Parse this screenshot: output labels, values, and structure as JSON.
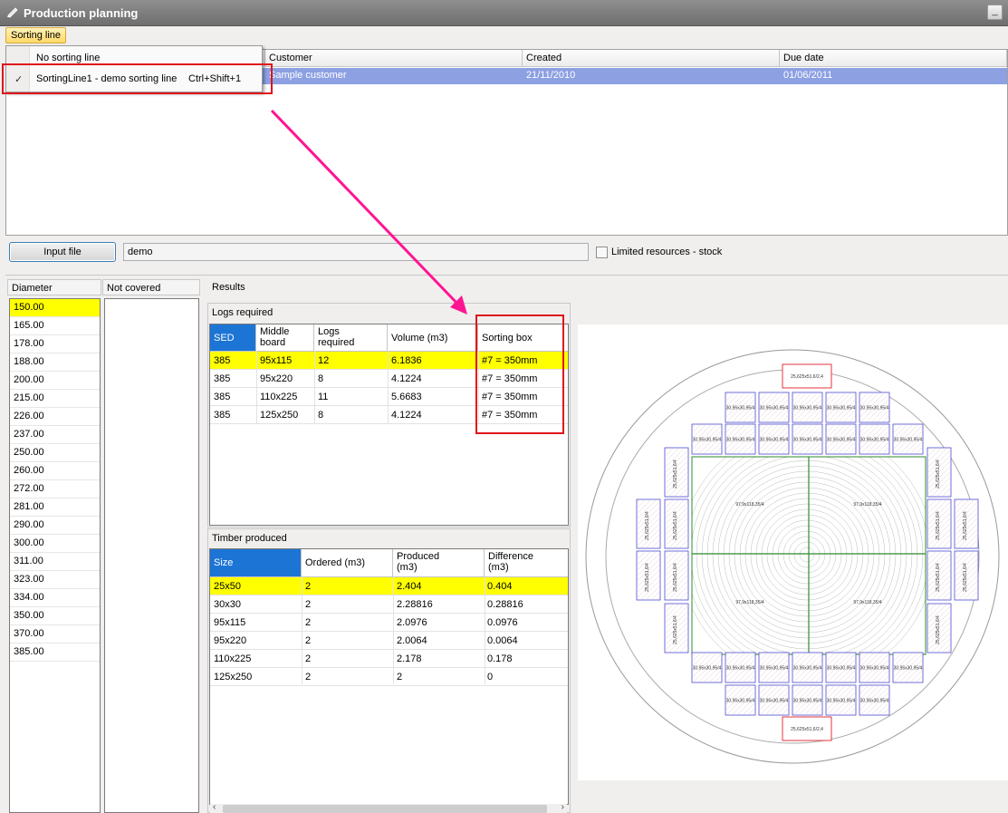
{
  "window": {
    "title": "Production planning",
    "minimize_glyph": "_"
  },
  "menu": {
    "sorting_line_label": "Sorting line"
  },
  "dropdown": {
    "option_none": "No sorting line",
    "option_selected": "SortingLine1 - demo sorting line",
    "option_shortcut": "Ctrl+Shift+1",
    "check_glyph": "✓"
  },
  "orders_grid": {
    "headers": [
      "Customer",
      "Created",
      "Due date"
    ],
    "row": {
      "customer": "Sample customer",
      "created": "21/11/2010",
      "due_date": "01/06/2011"
    }
  },
  "toolbar": {
    "input_file_label": "Input file",
    "file_value": "demo",
    "limited_resources_label": "Limited resources - stock"
  },
  "diameter_panel": {
    "title": "Diameter",
    "items": [
      "150.00",
      "165.00",
      "178.00",
      "188.00",
      "200.00",
      "215.00",
      "226.00",
      "237.00",
      "250.00",
      "260.00",
      "272.00",
      "281.00",
      "290.00",
      "300.00",
      "311.00",
      "323.00",
      "334.00",
      "350.00",
      "370.00",
      "385.00"
    ]
  },
  "not_covered_panel": {
    "title": "Not covered"
  },
  "results": {
    "title": "Results",
    "logs_required": {
      "title": "Logs required",
      "headers": {
        "sed": "SED",
        "middle_board": "Middle\nboard",
        "logs_required": "Logs\nrequired",
        "volume": "Volume (m3)",
        "sorting_box": "Sorting box"
      },
      "rows": [
        {
          "sed": "385",
          "middle_board": "95x115",
          "logs": "12",
          "volume": "6.1836",
          "box": "#7 = 350mm"
        },
        {
          "sed": "385",
          "middle_board": "95x220",
          "logs": "8",
          "volume": "4.1224",
          "box": "#7 = 350mm"
        },
        {
          "sed": "385",
          "middle_board": "110x225",
          "logs": "11",
          "volume": "5.6683",
          "box": "#7 = 350mm"
        },
        {
          "sed": "385",
          "middle_board": "125x250",
          "logs": "8",
          "volume": "4.1224",
          "box": "#7 = 350mm"
        }
      ]
    },
    "timber_produced": {
      "title": "Timber produced",
      "headers": {
        "size": "Size",
        "ordered": "Ordered (m3)",
        "produced": "Produced\n(m3)",
        "difference": "Difference\n(m3)"
      },
      "rows": [
        {
          "size": "25x50",
          "ordered": "2",
          "produced": "2.404",
          "difference": "0.404"
        },
        {
          "size": "30x30",
          "ordered": "2",
          "produced": "2.28816",
          "difference": "0.28816"
        },
        {
          "size": "95x115",
          "ordered": "2",
          "produced": "2.0976",
          "difference": "0.0976"
        },
        {
          "size": "95x220",
          "ordered": "2",
          "produced": "2.0064",
          "difference": "0.0064"
        },
        {
          "size": "110x225",
          "ordered": "2",
          "produced": "2.178",
          "difference": "0.178"
        },
        {
          "size": "125x250",
          "ordered": "2",
          "produced": "2",
          "difference": "0"
        }
      ]
    }
  },
  "cut_diagram": {
    "label_25": "25,625x51,6/2,4",
    "label_30": "30,95x30,95/4",
    "label_97": "97,9x118,35/4",
    "label_side": "25,625x51,6/4",
    "colors": {
      "blue": "#4a4ad0",
      "red": "#e0202a",
      "green": "#2e8b2e",
      "ring": "#bbbbbb"
    }
  },
  "annotation": {
    "color": "#ff1493"
  }
}
